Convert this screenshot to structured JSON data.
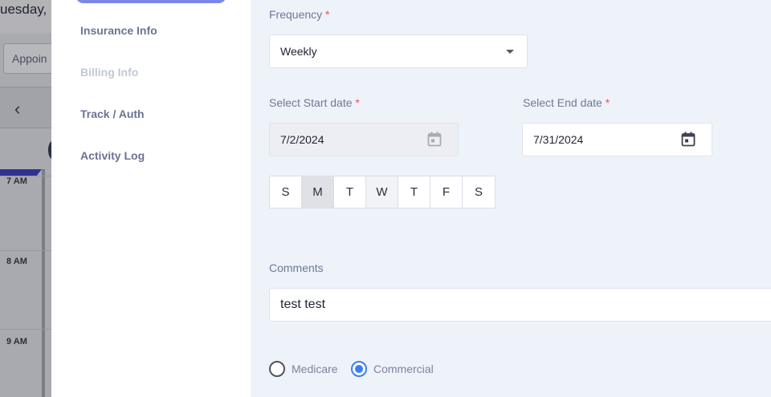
{
  "background": {
    "date_fragment": "uesday, ",
    "view_select": "Appoin",
    "nav_prev": "‹",
    "times": [
      "7 AM",
      "8 AM",
      "9 AM"
    ]
  },
  "sidebar": {
    "items": [
      {
        "label": "Insurance Info",
        "state": "normal"
      },
      {
        "label": "Billing Info",
        "state": "disabled"
      },
      {
        "label": "Track / Auth",
        "state": "normal"
      },
      {
        "label": "Activity Log",
        "state": "normal"
      }
    ]
  },
  "form": {
    "frequency": {
      "label": "Frequency",
      "required": "*",
      "value": "Weekly"
    },
    "start_date": {
      "label": "Select Start date",
      "required": "*",
      "value": "7/2/2024"
    },
    "end_date": {
      "label": "Select End date",
      "required": "*",
      "value": "7/31/2024"
    },
    "days": [
      {
        "label": "S",
        "state": "normal"
      },
      {
        "label": "M",
        "state": "selected"
      },
      {
        "label": "T",
        "state": "normal"
      },
      {
        "label": "W",
        "state": "light"
      },
      {
        "label": "T",
        "state": "normal"
      },
      {
        "label": "F",
        "state": "normal"
      },
      {
        "label": "S",
        "state": "normal"
      }
    ],
    "comments": {
      "label": "Comments",
      "value": "test test"
    },
    "coverage": {
      "options": [
        {
          "label": "Medicare",
          "checked": false
        },
        {
          "label": "Commercial",
          "checked": true
        }
      ]
    }
  },
  "colors": {
    "accent": "#3b7df0",
    "required": "#e05757",
    "active_tab": "#7c86e8",
    "panel_bg": "#eef2f9"
  }
}
